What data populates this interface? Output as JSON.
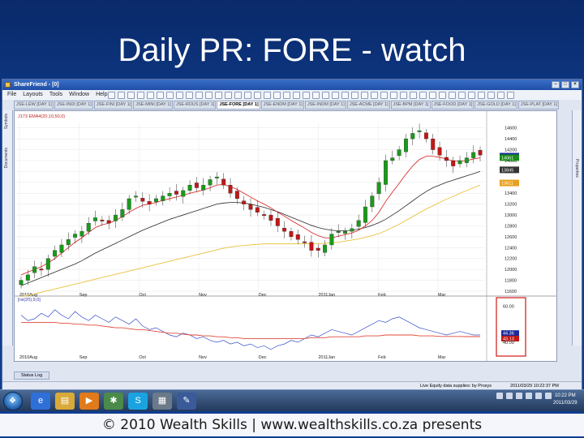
{
  "slide": {
    "title": "Daily PR: FORE - watch",
    "footer": "© 2010 Wealth Skills | www.wealthskills.co.za presents"
  },
  "window": {
    "title": "ShareFriend - [0]",
    "menu": [
      "File",
      "Layouts",
      "Tools",
      "Window",
      "Help"
    ]
  },
  "tabs": [
    {
      "label": "JSE-LEW [DAY 1]",
      "active": false
    },
    {
      "label": "JSE-INDI [DAY 1]",
      "active": false
    },
    {
      "label": "JSE-FINI [DAY 1]",
      "active": false
    },
    {
      "label": "JSE-MINI [DAY 1]",
      "active": false
    },
    {
      "label": "JSE-RDUS [DAY 1]",
      "active": false
    },
    {
      "label": "JSE-FORE [DAY 1]",
      "active": true
    },
    {
      "label": "JSE-ENDM [DAY 1]",
      "active": false
    },
    {
      "label": "JSE-INDM [DAY 1]",
      "active": false
    },
    {
      "label": "JSE-ACME [DAY 1]",
      "active": false
    },
    {
      "label": "JSE-BPM [DAY 1]",
      "active": false
    },
    {
      "label": "JSE-FOOD [DAY 1]",
      "active": false
    },
    {
      "label": "JSE-GOLD [DAY 1]",
      "active": false
    },
    {
      "label": "JSE-PLAT [DAY 1]",
      "active": false
    }
  ],
  "side": {
    "left_labels": [
      "Symbols",
      "Documents"
    ],
    "right_label": "Properties"
  },
  "colors": {
    "candle_up": "#1a9a1a",
    "candle_down": "#c01818",
    "ema_short": "#d81c1c",
    "ema_mid": "#2a2a2a",
    "ema_long": "#e8c23a",
    "rsi_line": "#3a4fc8",
    "rsi_avg": "#e04a3a"
  },
  "chart_data": {
    "type": "line",
    "legend_main": "J173 EMA4(20,10,50,0)",
    "legend_lower": "[rsi(20),9,0]",
    "x_labels": [
      "2010Aug",
      "Sep",
      "Oct",
      "Nov",
      "Dec",
      "2011Jan",
      "Feb",
      "Mar"
    ],
    "y_ticks_main": [
      14600,
      14400,
      14200,
      14000,
      13800,
      13600,
      13400,
      13200,
      13000,
      12800,
      12600,
      12400,
      12200,
      12000,
      11800,
      11600
    ],
    "ylim_main": [
      11600,
      14700
    ],
    "price_badges": [
      {
        "value": "14082",
        "color": "#1a2a9a"
      },
      {
        "value": "14061",
        "color": "#1a8a1a"
      },
      {
        "value": "13845",
        "color": "#333333"
      },
      {
        "value": "13611",
        "color": "#e8a020"
      }
    ],
    "price_series": [
      11800,
      11900,
      12050,
      12000,
      12200,
      12350,
      12450,
      12550,
      12650,
      12700,
      12850,
      12950,
      12900,
      12850,
      13000,
      13100,
      13300,
      13350,
      13250,
      13200,
      13300,
      13350,
      13400,
      13380,
      13450,
      13550,
      13500,
      13550,
      13650,
      13700,
      13550,
      13400,
      13300,
      13200,
      13100,
      13050,
      13000,
      12900,
      12800,
      12700,
      12600,
      12550,
      12500,
      12350,
      12350,
      12450,
      12650,
      12700,
      12700,
      12750,
      12900,
      13150,
      13350,
      13600,
      14000,
      14050,
      14200,
      14400,
      14500,
      14550,
      14400,
      14200,
      14100,
      14000,
      13900,
      14000,
      14050,
      14150,
      14100
    ],
    "ema_short": [
      11900,
      11950,
      12000,
      12050,
      12120,
      12200,
      12300,
      12400,
      12500,
      12580,
      12680,
      12770,
      12820,
      12850,
      12900,
      12970,
      13050,
      13120,
      13180,
      13200,
      13230,
      13270,
      13300,
      13330,
      13360,
      13400,
      13430,
      13460,
      13500,
      13550,
      13560,
      13520,
      13470,
      13400,
      13330,
      13260,
      13200,
      13130,
      13050,
      12980,
      12900,
      12830,
      12760,
      12680,
      12620,
      12580,
      12580,
      12610,
      12640,
      12670,
      12720,
      12800,
      12900,
      13050,
      13250,
      13420,
      13580,
      13750,
      13900,
      14020,
      14080,
      14080,
      14060,
      14030,
      13990,
      13990,
      14000,
      14030,
      14050
    ],
    "ema_mid": [
      11700,
      11750,
      11800,
      11850,
      11900,
      11950,
      12000,
      12050,
      12100,
      12160,
      12230,
      12300,
      12360,
      12420,
      12480,
      12540,
      12600,
      12660,
      12720,
      12770,
      12820,
      12870,
      12920,
      12960,
      13000,
      13040,
      13080,
      13120,
      13160,
      13200,
      13220,
      13230,
      13230,
      13220,
      13200,
      13170,
      13140,
      13100,
      13060,
      13010,
      12960,
      12910,
      12860,
      12810,
      12770,
      12740,
      12720,
      12710,
      12710,
      12720,
      12740,
      12770,
      12810,
      12860,
      12920,
      13000,
      13080,
      13170,
      13260,
      13350,
      13430,
      13500,
      13550,
      13600,
      13640,
      13680,
      13720,
      13760,
      13800
    ],
    "ema_long": [
      11500,
      11520,
      11550,
      11580,
      11610,
      11640,
      11670,
      11700,
      11730,
      11760,
      11790,
      11820,
      11850,
      11880,
      11910,
      11940,
      11970,
      12000,
      12030,
      12060,
      12090,
      12120,
      12150,
      12180,
      12210,
      12240,
      12270,
      12300,
      12330,
      12360,
      12390,
      12410,
      12430,
      12440,
      12450,
      12460,
      12470,
      12470,
      12470,
      12470,
      12470,
      12470,
      12470,
      12470,
      12470,
      12480,
      12490,
      12500,
      12520,
      12540,
      12560,
      12590,
      12620,
      12660,
      12710,
      12770,
      12830,
      12900,
      12970,
      13040,
      13110,
      13170,
      13230,
      13290,
      13340,
      13400,
      13450,
      13500,
      13550
    ],
    "y_ticks_lower": [
      "60.00",
      "44.36",
      "43.13",
      "40.00"
    ],
    "ylim_lower": [
      35,
      62
    ],
    "rsi": [
      55,
      52,
      53,
      56,
      54,
      58,
      55,
      53,
      57,
      54,
      52,
      55,
      53,
      51,
      54,
      52,
      50,
      53,
      49,
      47,
      48,
      46,
      44,
      43,
      45,
      44,
      42,
      43,
      41,
      40,
      41,
      39,
      40,
      38,
      39,
      37,
      38,
      36,
      38,
      39,
      41,
      40,
      42,
      44,
      43,
      45,
      47,
      46,
      45,
      44,
      46,
      48,
      50,
      52,
      51,
      53,
      54,
      52,
      50,
      48,
      47,
      46,
      45,
      44,
      45,
      46,
      45,
      44,
      44
    ],
    "rsi_avg": [
      51,
      51,
      51,
      51,
      51,
      51,
      50.5,
      50.5,
      50,
      50,
      49.5,
      49.5,
      49,
      48.5,
      48,
      48,
      47.5,
      47,
      47,
      46.5,
      46,
      45.5,
      45,
      45,
      44.5,
      44,
      44,
      43.5,
      43.5,
      43,
      43,
      42.5,
      42.5,
      42,
      42,
      42,
      42,
      42,
      42,
      42,
      42,
      42,
      42,
      42.5,
      42.5,
      42.5,
      43,
      43,
      43,
      43,
      43,
      43.5,
      43.5,
      43.5,
      44,
      44,
      44,
      44,
      44,
      43.5,
      43.5,
      43.5,
      43.2,
      43.2,
      43.2,
      43.2,
      43.1,
      43.1,
      43.1
    ]
  },
  "status": {
    "log_label": "Status Log",
    "live": "Live Equity data supplies: by Prosys",
    "time": "2011/03/29 10:22:37 PM"
  },
  "taskbar": {
    "clock_time": "10:22 PM",
    "clock_date": "2011/03/29"
  }
}
